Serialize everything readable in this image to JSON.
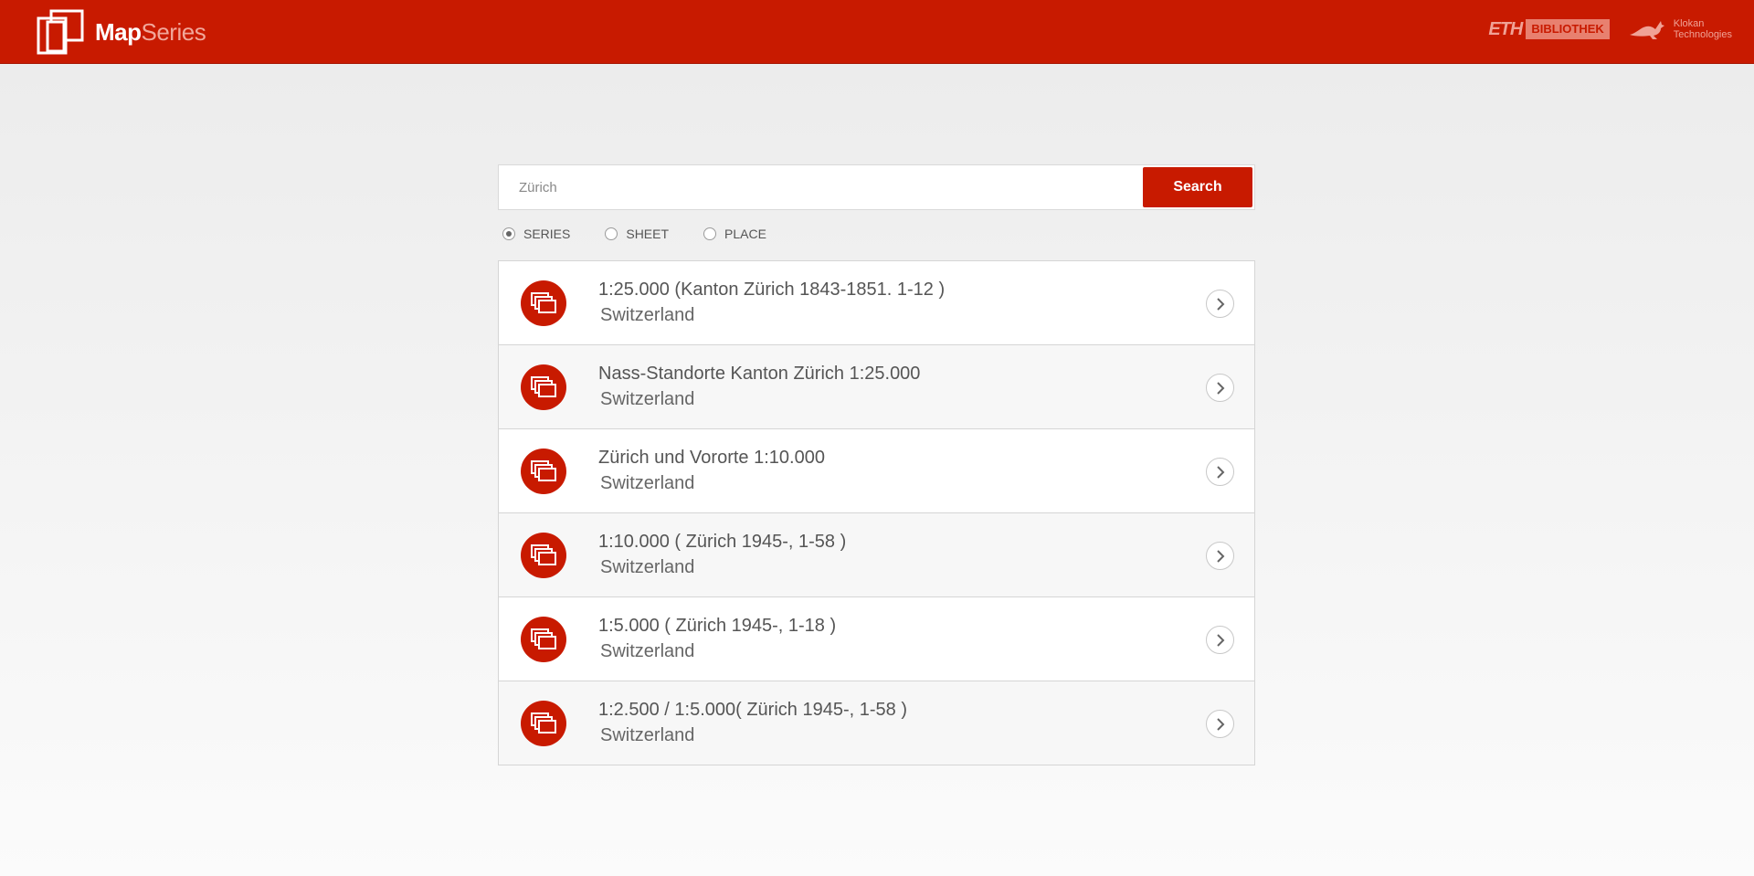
{
  "header": {
    "logo_bold": "Map",
    "logo_light": "Series",
    "eth_mark": "ETH",
    "eth_label": "BIBLIOTHEK",
    "klokan_line1": "Klokan",
    "klokan_line2": "Technologies"
  },
  "search": {
    "placeholder": "Zürich",
    "button_label": "Search"
  },
  "modes": [
    {
      "label": "SERIES",
      "checked": true
    },
    {
      "label": "SHEET",
      "checked": false
    },
    {
      "label": "PLACE",
      "checked": false
    }
  ],
  "results": [
    {
      "title": "1:25.000 (Kanton Zürich 1843-1851. 1-12 )",
      "subtitle": "Switzerland"
    },
    {
      "title": "Nass-Standorte Kanton Zürich 1:25.000",
      "subtitle": "Switzerland"
    },
    {
      "title": "Zürich und Vororte 1:10.000",
      "subtitle": "Switzerland"
    },
    {
      "title": "1:10.000 ( Zürich 1945-, 1-58 )",
      "subtitle": "Switzerland"
    },
    {
      "title": "1:5.000 ( Zürich 1945-, 1-18 )",
      "subtitle": "Switzerland"
    },
    {
      "title": "1:2.500 / 1:5.000( Zürich 1945-, 1-58 )",
      "subtitle": "Switzerland"
    }
  ],
  "colors": {
    "brand": "#c81a00"
  }
}
